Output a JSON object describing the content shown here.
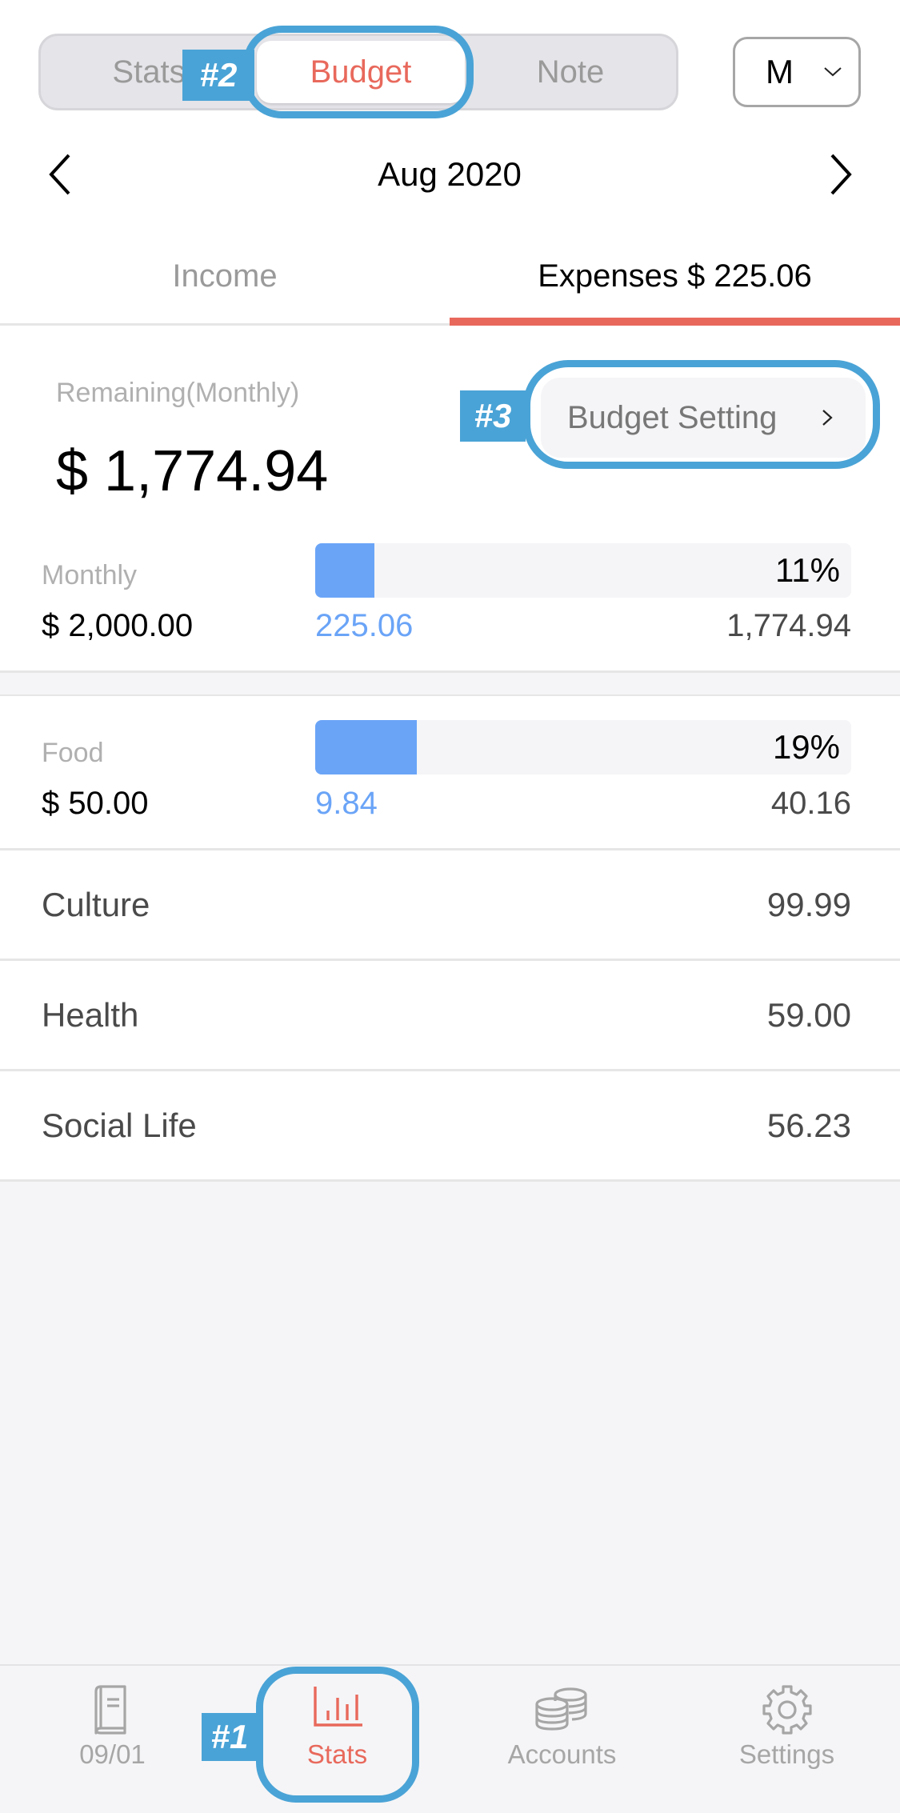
{
  "header": {
    "segments": [
      {
        "label": "Stats",
        "selected": false
      },
      {
        "label": "Budget",
        "selected": true
      },
      {
        "label": "Note",
        "selected": false
      }
    ],
    "period_select": {
      "value": "M",
      "icon": "chevron-down-icon"
    },
    "month": {
      "label": "Aug 2020",
      "prev_icon": "chevron-left-icon",
      "next_icon": "chevron-right-icon"
    },
    "tabs": [
      {
        "label": "Income",
        "selected": false
      },
      {
        "label": "Expenses $ 225.06",
        "selected": true
      }
    ]
  },
  "summary": {
    "remaining_label": "Remaining(Monthly)",
    "remaining_amount": "$ 1,774.94",
    "budget_setting_label": "Budget Setting",
    "budget_setting_icon": "chevron-right-icon"
  },
  "budgets": [
    {
      "label": "Monthly",
      "amount": "$ 2,000.00",
      "percent_label": "11%",
      "progress": 0.11,
      "spent": "225.06",
      "remaining": "1,774.94"
    },
    {
      "label": "Food",
      "amount": "$ 50.00",
      "percent_label": "19%",
      "progress": 0.19,
      "spent": "9.84",
      "remaining": "40.16"
    }
  ],
  "categories": [
    {
      "name": "Culture",
      "value": "99.99"
    },
    {
      "name": "Health",
      "value": "59.00"
    },
    {
      "name": "Social Life",
      "value": "56.23"
    }
  ],
  "bottom_nav": [
    {
      "label": "09/01",
      "icon": "book-icon",
      "active": false
    },
    {
      "label": "Stats",
      "icon": "bar-chart-icon",
      "active": true
    },
    {
      "label": "Accounts",
      "icon": "coins-icon",
      "active": false
    },
    {
      "label": "Settings",
      "icon": "gear-icon",
      "active": false
    }
  ],
  "annotations": [
    {
      "label": "#1",
      "target": "Stats tab"
    },
    {
      "label": "#2",
      "target": "Budget segment"
    },
    {
      "label": "#3",
      "target": "Budget Setting button"
    }
  ],
  "colors": {
    "accent": "#e8695c",
    "progress": "#6aa4f7",
    "annotation": "#4aa3d6",
    "muted_text": "#9a9a9a",
    "background": "#f5f5f7"
  }
}
